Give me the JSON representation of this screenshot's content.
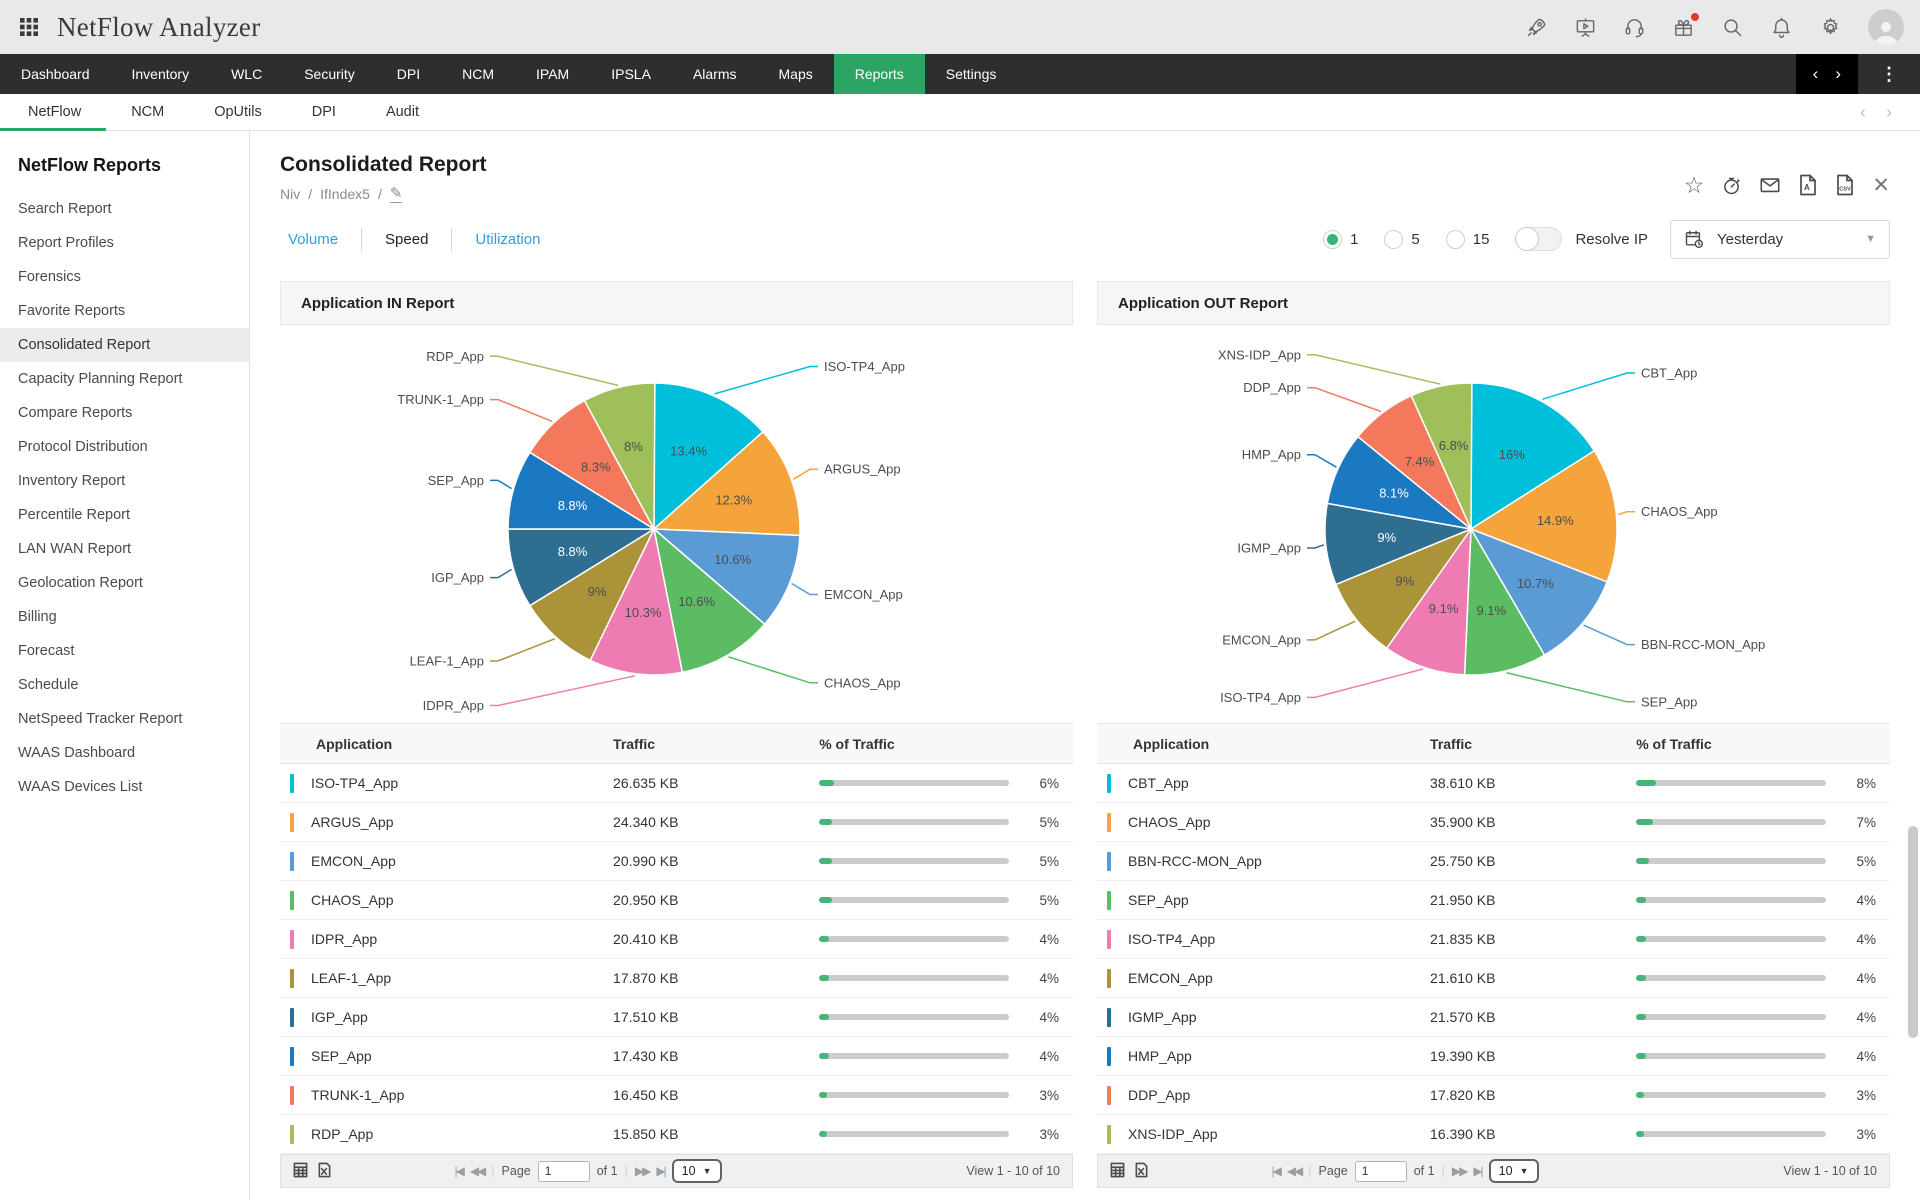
{
  "topbar": {
    "app_title": "NetFlow Analyzer",
    "icon_names": [
      "apps-grid-icon",
      "rocket-icon",
      "presentation-icon",
      "headset-icon",
      "gift-icon",
      "search-icon",
      "bell-icon",
      "gear-icon",
      "avatar"
    ]
  },
  "main_nav": {
    "items": [
      "Dashboard",
      "Inventory",
      "WLC",
      "Security",
      "DPI",
      "NCM",
      "IPAM",
      "IPSLA",
      "Alarms",
      "Maps",
      "Reports",
      "Settings"
    ],
    "active": "Reports",
    "icon_names": [
      "prev-chevron-icon",
      "next-chevron-icon",
      "kebab-menu-icon"
    ]
  },
  "sub_nav": {
    "items": [
      "NetFlow",
      "NCM",
      "OpUtils",
      "DPI",
      "Audit"
    ],
    "active": "NetFlow",
    "icon_names": [
      "prev-chevron-icon",
      "next-chevron-icon"
    ]
  },
  "sidebar": {
    "title": "NetFlow Reports",
    "items": [
      "Search Report",
      "Report Profiles",
      "Forensics",
      "Favorite Reports",
      "Consolidated Report",
      "Capacity Planning Report",
      "Compare Reports",
      "Protocol Distribution",
      "Inventory Report",
      "Percentile Report",
      "LAN WAN Report",
      "Geolocation Report",
      "Billing",
      "Forecast",
      "Schedule",
      "NetSpeed Tracker Report",
      "WAAS Dashboard",
      "WAAS Devices List"
    ],
    "active": "Consolidated Report"
  },
  "report": {
    "title": "Consolidated Report",
    "breadcrumb_device": "Niv",
    "breadcrumb_separator": "/",
    "breadcrumb_interface": "IfIndex5",
    "toolbar_icon_names": [
      "favorite-star-icon",
      "history-timer-icon",
      "email-icon",
      "pdf-export-icon",
      "csv-export-icon",
      "close-icon"
    ]
  },
  "controls": {
    "metric_tabs": [
      "Volume",
      "Speed",
      "Utilization"
    ],
    "metric_active": "Speed",
    "interval_options": [
      "1",
      "5",
      "15"
    ],
    "interval_selected": "1",
    "resolve_ip_label": "Resolve IP",
    "resolve_ip_enabled": false,
    "date_icon_name": "calendar-clock-icon",
    "date_range_value": "Yesterday"
  },
  "table_headers": [
    "Application",
    "Traffic",
    "% of Traffic"
  ],
  "chart_data": [
    {
      "type": "pie",
      "title": "Application IN Report",
      "legend_position": "callout-labels",
      "slices": [
        {
          "label": "ISO-TP4_App",
          "value_pct": 13.4,
          "display": "13.4%",
          "color": "#00bfdb"
        },
        {
          "label": "ARGUS_App",
          "value_pct": 12.3,
          "display": "12.3%",
          "color": "#f5a43c"
        },
        {
          "label": "EMCON_App",
          "value_pct": 10.6,
          "display": "10.6%",
          "color": "#5b9bd5"
        },
        {
          "label": "CHAOS_App",
          "value_pct": 10.6,
          "display": "10.6%",
          "color": "#5bbc64"
        },
        {
          "label": "IDPR_App",
          "value_pct": 10.3,
          "display": "10.3%",
          "color": "#ee7cb3"
        },
        {
          "label": "LEAF-1_App",
          "value_pct": 9,
          "display": "9%",
          "color": "#ab9339"
        },
        {
          "label": "IGP_App",
          "value_pct": 8.8,
          "display": "8.8%",
          "color": "#2e6e90",
          "text_color": "#ffffff"
        },
        {
          "label": "SEP_App",
          "value_pct": 8.8,
          "display": "8.8%",
          "color": "#1b79c2",
          "text_color": "#ffffff"
        },
        {
          "label": "TRUNK-1_App",
          "value_pct": 8.3,
          "display": "8.3%",
          "color": "#f4795c"
        },
        {
          "label": "RDP_App",
          "value_pct": 8,
          "display": "8%",
          "color": "#9fbf5b"
        }
      ]
    },
    {
      "type": "pie",
      "title": "Application OUT Report",
      "legend_position": "callout-labels",
      "slices": [
        {
          "label": "CBT_App",
          "value_pct": 16,
          "display": "16%",
          "color": "#00bfdb"
        },
        {
          "label": "CHAOS_App",
          "value_pct": 14.9,
          "display": "14.9%",
          "color": "#f5a43c"
        },
        {
          "label": "BBN-RCC-MON_App",
          "value_pct": 10.7,
          "display": "10.7%",
          "color": "#5b9bd5"
        },
        {
          "label": "SEP_App",
          "value_pct": 9.1,
          "display": "9.1%",
          "color": "#5bbc64"
        },
        {
          "label": "ISO-TP4_App",
          "value_pct": 9.1,
          "display": "9.1%",
          "color": "#ee7cb3"
        },
        {
          "label": "EMCON_App",
          "value_pct": 9,
          "display": "9%",
          "color": "#ab9339"
        },
        {
          "label": "IGMP_App",
          "value_pct": 9,
          "display": "9%",
          "color": "#2e6e90",
          "text_color": "#ffffff"
        },
        {
          "label": "HMP_App",
          "value_pct": 8.1,
          "display": "8.1%",
          "color": "#1b79c2",
          "text_color": "#ffffff"
        },
        {
          "label": "DDP_App",
          "value_pct": 7.4,
          "display": "7.4%",
          "color": "#f4795c"
        },
        {
          "label": "XNS-IDP_App",
          "value_pct": 6.8,
          "display": "6.8%",
          "color": "#9fbf5b"
        }
      ]
    }
  ],
  "tables": [
    {
      "rows": [
        {
          "app": "ISO-TP4_App",
          "traffic": "26.635 KB",
          "pct_label": "6%",
          "pct_value": 6,
          "color": "#00bfdb"
        },
        {
          "app": "ARGUS_App",
          "traffic": "24.340 KB",
          "pct_label": "5%",
          "pct_value": 5,
          "color": "#f5a43c"
        },
        {
          "app": "EMCON_App",
          "traffic": "20.990 KB",
          "pct_label": "5%",
          "pct_value": 5,
          "color": "#5b9bd5"
        },
        {
          "app": "CHAOS_App",
          "traffic": "20.950 KB",
          "pct_label": "5%",
          "pct_value": 5,
          "color": "#5bbc64"
        },
        {
          "app": "IDPR_App",
          "traffic": "20.410 KB",
          "pct_label": "4%",
          "pct_value": 4,
          "color": "#ee7cb3"
        },
        {
          "app": "LEAF-1_App",
          "traffic": "17.870 KB",
          "pct_label": "4%",
          "pct_value": 4,
          "color": "#ab9339"
        },
        {
          "app": "IGP_App",
          "traffic": "17.510 KB",
          "pct_label": "4%",
          "pct_value": 4,
          "color": "#2e6e90"
        },
        {
          "app": "SEP_App",
          "traffic": "17.430 KB",
          "pct_label": "4%",
          "pct_value": 4,
          "color": "#1b79c2"
        },
        {
          "app": "TRUNK-1_App",
          "traffic": "16.450 KB",
          "pct_label": "3%",
          "pct_value": 3,
          "color": "#f4795c"
        },
        {
          "app": "RDP_App",
          "traffic": "15.850 KB",
          "pct_label": "3%",
          "pct_value": 3,
          "color": "#9fbf5b"
        }
      ]
    },
    {
      "rows": [
        {
          "app": "CBT_App",
          "traffic": "38.610 KB",
          "pct_label": "8%",
          "pct_value": 8,
          "color": "#00bfdb"
        },
        {
          "app": "CHAOS_App",
          "traffic": "35.900 KB",
          "pct_label": "7%",
          "pct_value": 7,
          "color": "#f5a43c"
        },
        {
          "app": "BBN-RCC-MON_App",
          "traffic": "25.750 KB",
          "pct_label": "5%",
          "pct_value": 5,
          "color": "#5b9bd5"
        },
        {
          "app": "SEP_App",
          "traffic": "21.950 KB",
          "pct_label": "4%",
          "pct_value": 4,
          "color": "#5bbc64"
        },
        {
          "app": "ISO-TP4_App",
          "traffic": "21.835 KB",
          "pct_label": "4%",
          "pct_value": 4,
          "color": "#ee7cb3"
        },
        {
          "app": "EMCON_App",
          "traffic": "21.610 KB",
          "pct_label": "4%",
          "pct_value": 4,
          "color": "#ab9339"
        },
        {
          "app": "IGMP_App",
          "traffic": "21.570 KB",
          "pct_label": "4%",
          "pct_value": 4,
          "color": "#2e6e90"
        },
        {
          "app": "HMP_App",
          "traffic": "19.390 KB",
          "pct_label": "4%",
          "pct_value": 4,
          "color": "#1b79c2"
        },
        {
          "app": "DDP_App",
          "traffic": "17.820 KB",
          "pct_label": "3%",
          "pct_value": 3,
          "color": "#f4795c"
        },
        {
          "app": "XNS-IDP_App",
          "traffic": "16.390 KB",
          "pct_label": "3%",
          "pct_value": 3,
          "color": "#9fbf5b"
        }
      ]
    }
  ],
  "pagination": {
    "export_icon_names": [
      "report-table-icon",
      "excel-export-icon"
    ],
    "nav_icon_names": [
      "first-page-icon",
      "prev-page-icon",
      "next-page-icon",
      "last-page-icon"
    ],
    "page_label": "Page",
    "page_value": "1",
    "of_text": "of 1",
    "page_size": "10",
    "view_text": "View 1 - 10 of 10"
  },
  "colors": {
    "nav_active_green": "#2ca463",
    "link_blue": "#2e9fe0",
    "radio_selected_green": "#35b57a",
    "progress_fill_green": "#46b578",
    "progress_track_gray": "#cbcbcb"
  }
}
